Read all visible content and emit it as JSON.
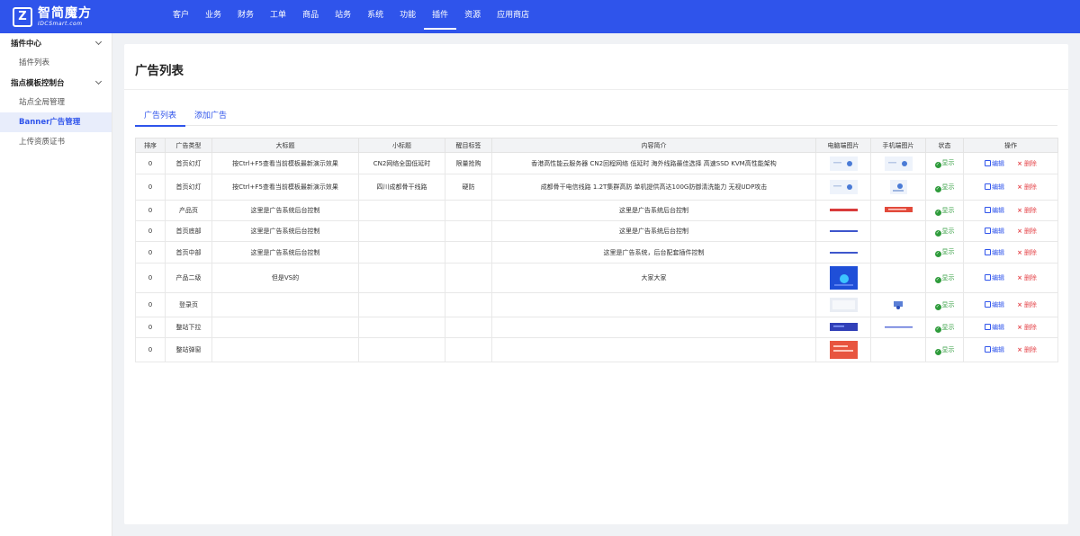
{
  "brand": {
    "logo_main": "智简魔方",
    "logo_sub": "IDCSmart.com"
  },
  "nav": [
    "客户",
    "业务",
    "财务",
    "工单",
    "商品",
    "站务",
    "系统",
    "功能",
    "插件",
    "资源",
    "应用商店"
  ],
  "nav_active": "插件",
  "sidebar": {
    "groups": [
      {
        "title": "插件中心",
        "items": [
          {
            "label": "插件列表"
          }
        ]
      },
      {
        "title": "指点模板控制台",
        "items": [
          {
            "label": "站点全局管理"
          },
          {
            "label": "Banner广告管理"
          },
          {
            "label": "上传资质证书"
          }
        ]
      }
    ],
    "active": "Banner广告管理"
  },
  "page_title": "广告列表",
  "tabs": [
    "广告列表",
    "添加广告"
  ],
  "table": {
    "headers": [
      "排序",
      "广告类型",
      "大标题",
      "小标题",
      "醒目标签",
      "内容简介",
      "电脑端图片",
      "手机端图片",
      "状态",
      "操作"
    ],
    "status_label": "显示",
    "edit_label": "编辑",
    "delete_label": "删除",
    "rows": [
      {
        "order": "0",
        "type": "首页幻灯",
        "title": "按Ctrl+F5查看当前模板最新演示效果",
        "subtitle": "CN2网络全国低延时",
        "tag": "限量抢购",
        "desc": "香港高性能云服务器 CN2回程网络 低延时 海外线路最佳选择 高速SSD KVM高性能架构",
        "pc_img": "banner-light",
        "m_img": "banner-light",
        "h": 24
      },
      {
        "order": "0",
        "type": "首页幻灯",
        "title": "按Ctrl+F5查看当前模板最新演示效果",
        "subtitle": "四川成都骨干线路",
        "tag": "硬防",
        "desc": "成都骨干电信线路 1.2T集群高防 单机提供高达100G防御清洗能力 无视UDP攻击",
        "pc_img": "banner-light",
        "m_img": "banner-light-phone",
        "h": 29
      },
      {
        "order": "0",
        "type": "产品页",
        "title": "这里是广告系统后台控制",
        "subtitle": "",
        "tag": "",
        "desc": "这里是广告系统后台控制",
        "pc_img": "strip-red",
        "m_img": "strip-red-wide",
        "h": 23
      },
      {
        "order": "0",
        "type": "首页底部",
        "title": "这里是广告系统后台控制",
        "subtitle": "",
        "tag": "",
        "desc": "这里是广告系统后台控制",
        "pc_img": "strip-blue",
        "m_img": "",
        "h": 23
      },
      {
        "order": "0",
        "type": "首页中部",
        "title": "这里是广告系统后台控制",
        "subtitle": "",
        "tag": "",
        "desc": "这里是广告系统，后台配套插件控制",
        "pc_img": "strip-blue",
        "m_img": "",
        "h": 24
      },
      {
        "order": "0",
        "type": "产品二级",
        "title": "但是VS的",
        "subtitle": "",
        "tag": "",
        "desc": "大家大家",
        "pc_img": "square-blue",
        "m_img": "",
        "h": 33
      },
      {
        "order": "0",
        "type": "登录页",
        "title": "",
        "subtitle": "",
        "tag": "",
        "desc": "",
        "pc_img": "login-light",
        "m_img": "login-phone",
        "h": 27
      },
      {
        "order": "0",
        "type": "整站下拉",
        "title": "",
        "subtitle": "",
        "tag": "",
        "desc": "",
        "pc_img": "dropdown-blue",
        "m_img": "thin-blue",
        "h": 23
      },
      {
        "order": "0",
        "type": "整站弹窗",
        "title": "",
        "subtitle": "",
        "tag": "",
        "desc": "",
        "pc_img": "popup-red",
        "m_img": "",
        "h": 27
      }
    ]
  },
  "colors": {
    "primary": "#2f54eb",
    "success": "#2e9b3b",
    "danger": "#e5484d"
  }
}
